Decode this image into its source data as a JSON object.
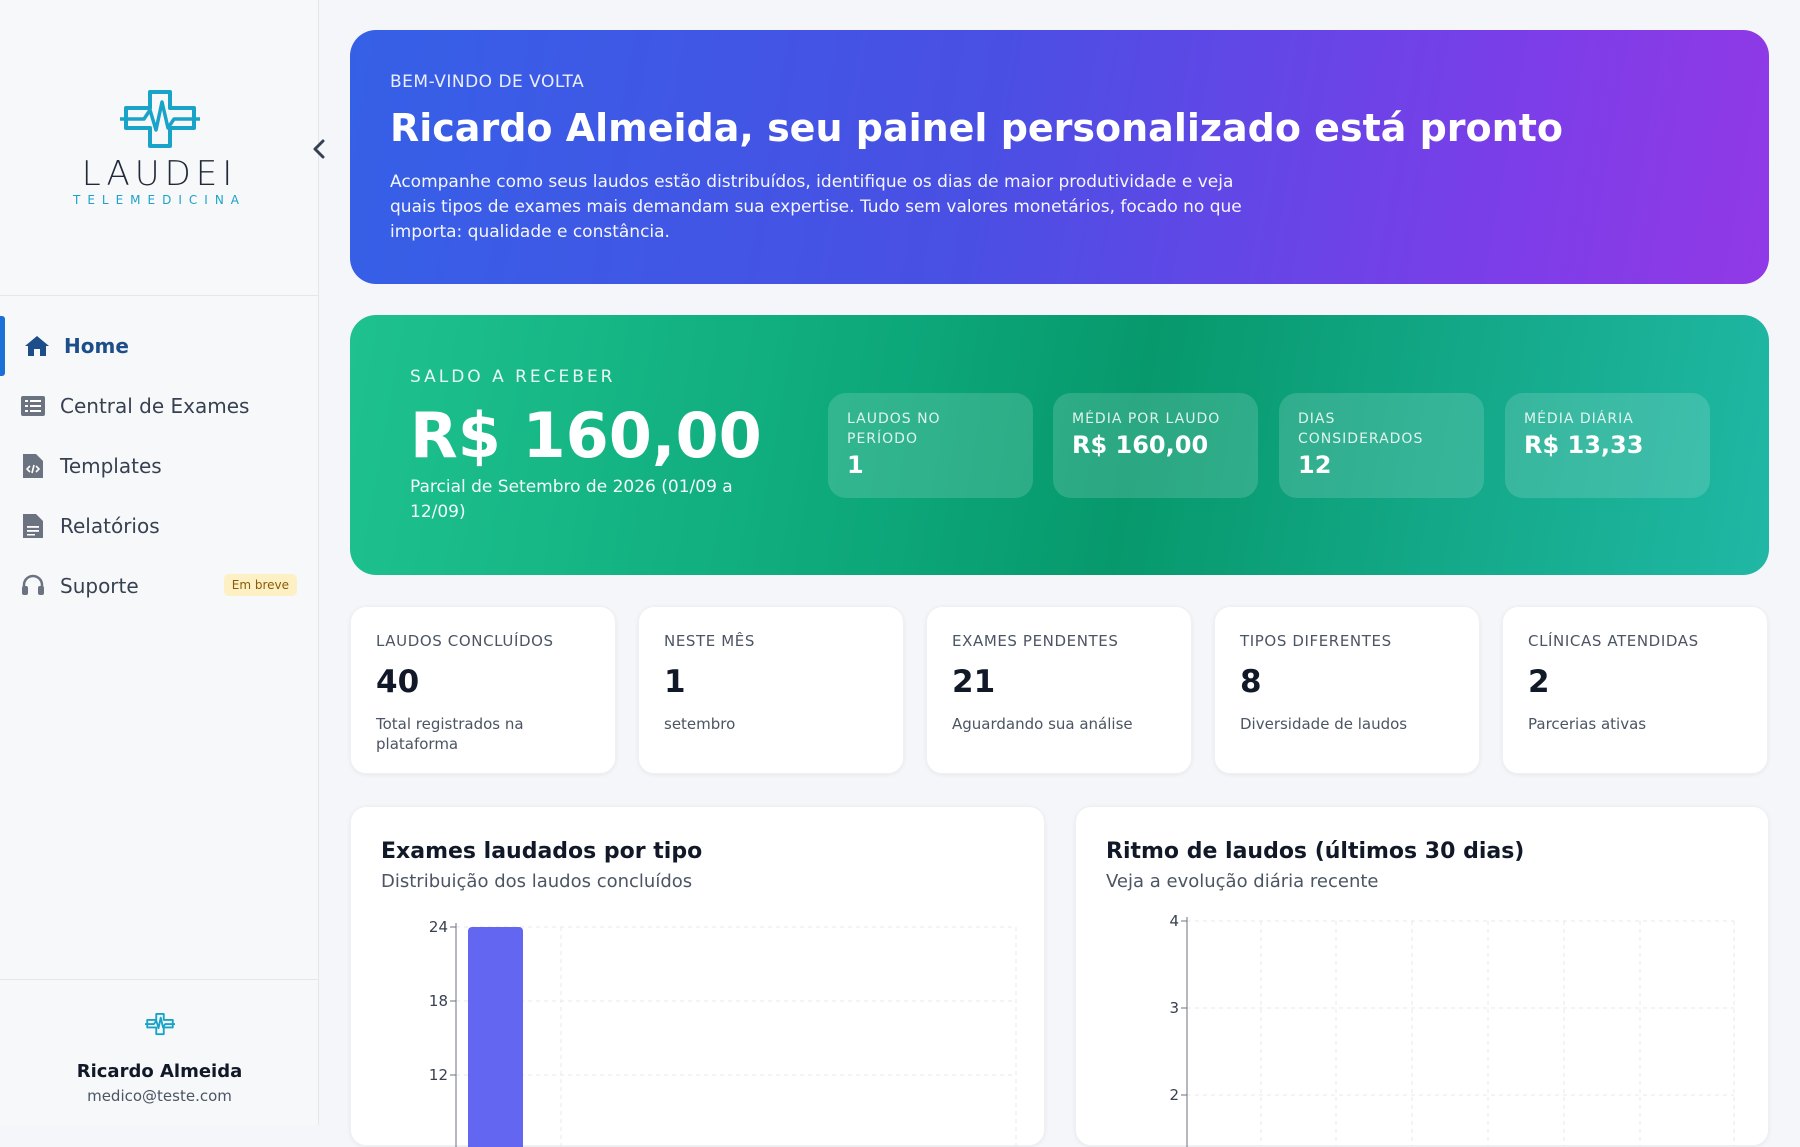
{
  "brand": {
    "name": "LAUDEI",
    "tagline": "TELEMEDICINA",
    "primary": "#1aa3c9"
  },
  "sidebar": {
    "items": [
      {
        "label": "Home",
        "icon": "home-icon",
        "active": true
      },
      {
        "label": "Central de Exames",
        "icon": "list-icon"
      },
      {
        "label": "Templates",
        "icon": "code-file-icon"
      },
      {
        "label": "Relatórios",
        "icon": "document-icon"
      },
      {
        "label": "Suporte",
        "icon": "headset-icon",
        "badge": "Em breve"
      }
    ],
    "user": {
      "name": "Ricardo Almeida",
      "email": "medico@teste.com"
    }
  },
  "hero": {
    "kicker": "BEM-VINDO DE VOLTA",
    "title": "Ricardo Almeida, seu painel personalizado está pronto",
    "text": "Acompanhe como seus laudos estão distribuídos, identifique os dias de maior produtividade e veja quais tipos de exames mais demandam sua expertise. Tudo sem valores monetários, focado no que importa: qualidade e constância."
  },
  "balance": {
    "kicker": "SALDO A RECEBER",
    "value": "R$ 160,00",
    "sub": "Parcial de Setembro de 2026 (01/09 a 12/09)",
    "metrics": [
      {
        "label": "Laudos no período",
        "value": "1"
      },
      {
        "label": "Média por laudo",
        "value": "R$ 160,00"
      },
      {
        "label": "Dias considerados",
        "value": "12"
      },
      {
        "label": "Média diária",
        "value": "R$ 13,33"
      }
    ]
  },
  "stats": [
    {
      "label": "Laudos concluídos",
      "value": "40",
      "sub": "Total registrados na plataforma"
    },
    {
      "label": "Neste mês",
      "value": "1",
      "sub": "setembro"
    },
    {
      "label": "Exames pendentes",
      "value": "21",
      "sub": "Aguardando sua análise"
    },
    {
      "label": "Tipos diferentes",
      "value": "8",
      "sub": "Diversidade de laudos"
    },
    {
      "label": "Clínicas atendidas",
      "value": "2",
      "sub": "Parcerias ativas"
    }
  ],
  "charts": {
    "by_type": {
      "title": "Exames laudados por tipo",
      "subtitle": "Distribuição dos laudos concluídos"
    },
    "rhythm": {
      "title": "Ritmo de laudos (últimos 30 dias)",
      "subtitle": "Veja a evolução diária recente"
    }
  },
  "chart_data": [
    {
      "type": "bar",
      "title": "Exames laudados por tipo",
      "y_ticks": [
        "24",
        "18",
        "12"
      ],
      "ylim": [
        0,
        24
      ],
      "values": [
        24
      ],
      "grid": true,
      "color": "#6366f1"
    },
    {
      "type": "line",
      "title": "Ritmo de laudos (últimos 30 dias)",
      "y_ticks": [
        "4",
        "3",
        "2"
      ],
      "ylim": [
        0,
        4
      ],
      "grid": true
    }
  ]
}
